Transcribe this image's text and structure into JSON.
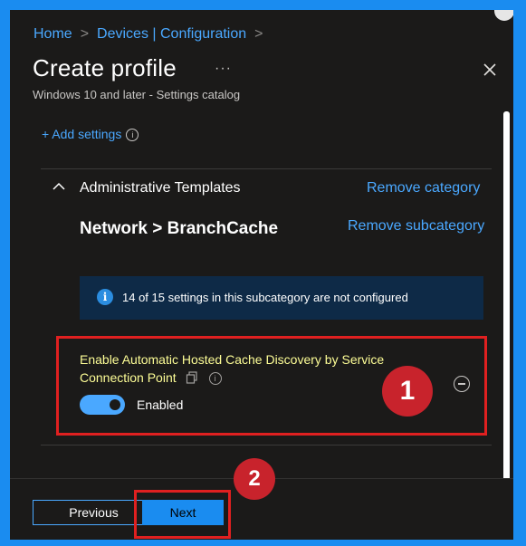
{
  "breadcrumb": {
    "home": "Home",
    "devices": "Devices | Configuration"
  },
  "header": {
    "title": "Create profile",
    "more": "···",
    "subtitle": "Windows 10 and later - Settings catalog"
  },
  "add_settings": "+ Add settings",
  "category": {
    "name": "Administrative Templates",
    "remove_category": "Remove category",
    "subcategory": "Network > BranchCache",
    "remove_subcategory": "Remove subcategory"
  },
  "info_bar": {
    "icon": "i",
    "text": "14 of 15 settings in this subcategory are not configured"
  },
  "setting": {
    "name_line1": "Enable Automatic Hosted Cache Discovery by Service",
    "name_line2": "Connection Point",
    "toggle_value": "Enabled",
    "toggle_on": true
  },
  "annotations": {
    "badge1": "1",
    "badge2": "2"
  },
  "footer": {
    "previous": "Previous",
    "next": "Next"
  },
  "colors": {
    "accent": "#4aa8ff",
    "highlight_box": "#e02020",
    "badge": "#c8232c",
    "setting_text": "#fdfd96",
    "frame": "#1a8cf0"
  }
}
